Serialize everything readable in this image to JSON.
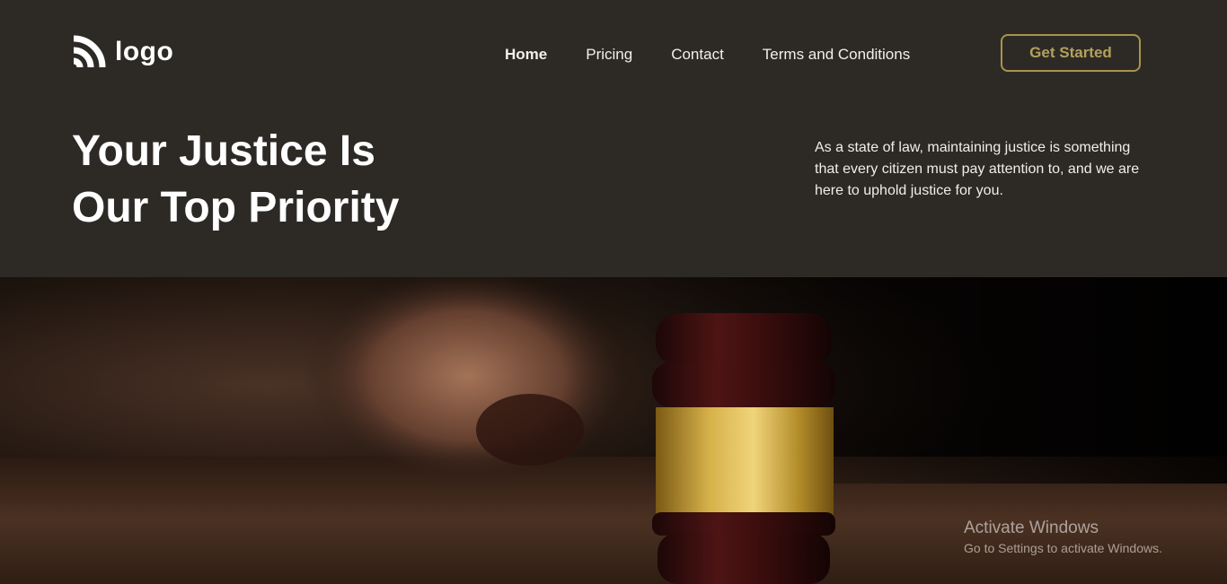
{
  "brand": {
    "logo_text": "logo",
    "logo_icon": "wifi-waves-icon"
  },
  "nav": {
    "items": [
      {
        "label": "Home",
        "active": true
      },
      {
        "label": "Pricing",
        "active": false
      },
      {
        "label": "Contact",
        "active": false
      },
      {
        "label": "Terms and Conditions",
        "active": false
      }
    ],
    "cta_label": "Get Started"
  },
  "hero": {
    "headline_line1": "Your Justice Is",
    "headline_line2": "Our Top Priority",
    "description": "As a state of law, maintaining justice is something that every citizen must pay attention to, and we are here to uphold justice for you.",
    "image": "gavel-photo"
  },
  "watermark": {
    "title": "Activate Windows",
    "subtitle": "Go to Settings to activate Windows."
  },
  "colors": {
    "background": "#2d2a26",
    "accent": "#a8954a",
    "text": "#ffffff"
  }
}
